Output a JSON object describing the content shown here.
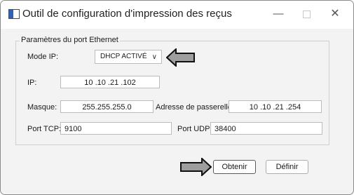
{
  "window": {
    "title": "Outil de configuration d'impression des reçus"
  },
  "window_controls": {
    "minimize": "—",
    "close": "✕"
  },
  "group": {
    "legend": "Paramètres du port Ethernet",
    "mode_ip": {
      "label": "Mode IP:",
      "value": "DHCP ACTIVÉ",
      "chevron": "∨"
    },
    "ip": {
      "label": "IP:",
      "value": "10 .10 .21 .102"
    },
    "masque": {
      "label": "Masque:",
      "value": "255.255.255.0"
    },
    "passerelle": {
      "label": "Adresse de passerelle:",
      "value": "10 .10 .21 .254"
    },
    "port_tcp": {
      "label": "Port TCP:",
      "value": "9100"
    },
    "port_udp": {
      "label": "Port UDP:",
      "value": "38400"
    }
  },
  "buttons": {
    "obtenir": "Obtenir",
    "definir": "Définir"
  },
  "icons": {
    "app": "app-window-icon",
    "arrow": "pointer-arrow-icon"
  },
  "colors": {
    "arrow_fill": "#9e9e9e",
    "arrow_stroke": "#111111",
    "accent": "#2d63b8"
  }
}
